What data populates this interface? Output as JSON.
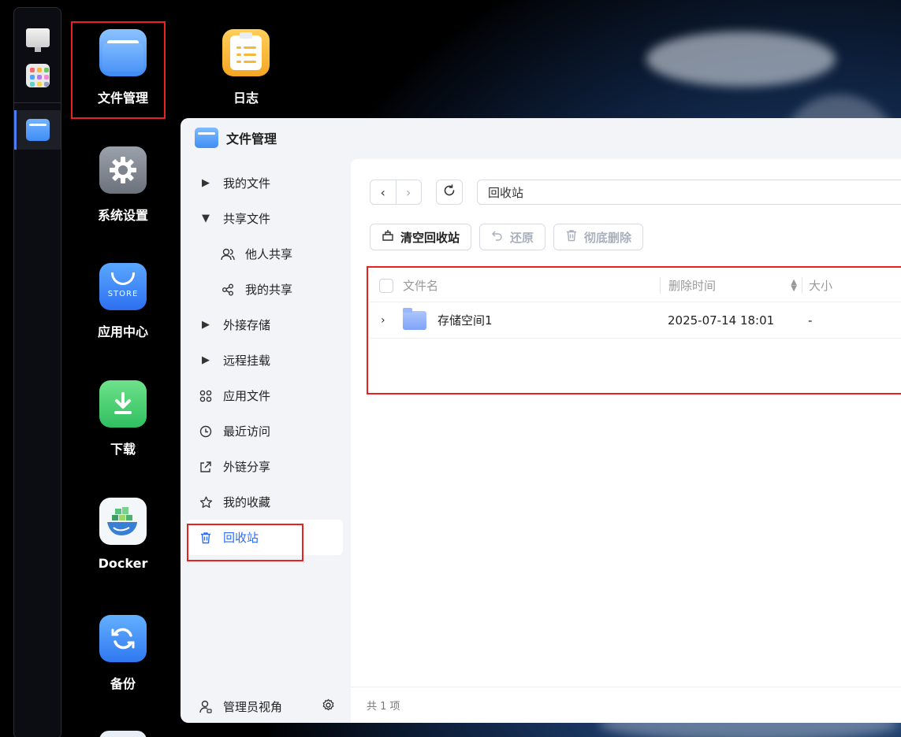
{
  "desktop": {
    "icons": [
      {
        "label": "文件管理"
      },
      {
        "label": "日志"
      },
      {
        "label": "系统设置"
      },
      {
        "label": "应用中心",
        "tile_text": "STORE"
      },
      {
        "label": "下载"
      },
      {
        "label": "Docker"
      },
      {
        "label": "备份"
      }
    ]
  },
  "window": {
    "title": "文件管理",
    "nav": [
      {
        "label": "我的文件",
        "icon": "caret-right-icon"
      },
      {
        "label": "共享文件",
        "icon": "caret-down-icon"
      },
      {
        "label": "他人共享",
        "icon": "users-icon"
      },
      {
        "label": "我的共享",
        "icon": "share-icon"
      },
      {
        "label": "外接存储",
        "icon": "caret-right-icon"
      },
      {
        "label": "远程挂载",
        "icon": "caret-right-icon"
      },
      {
        "label": "应用文件",
        "icon": "apps-icon"
      },
      {
        "label": "最近访问",
        "icon": "clock-icon"
      },
      {
        "label": "外链分享",
        "icon": "external-share-icon"
      },
      {
        "label": "我的收藏",
        "icon": "star-icon"
      },
      {
        "label": "回收站",
        "icon": "trash-icon"
      }
    ],
    "admin_view": "管理员视角",
    "path": "回收站",
    "actions": {
      "empty": "清空回收站",
      "restore": "还原",
      "delete": "彻底删除"
    },
    "table": {
      "headers": {
        "name": "文件名",
        "time": "删除时间",
        "size": "大小"
      },
      "rows": [
        {
          "name": "存储空间1",
          "time": "2025-07-14 18:01",
          "size": "-"
        }
      ]
    },
    "footer": "共 1 项"
  },
  "colors": {
    "accent": "#2f6df6",
    "highlight_box": "#e8231f"
  }
}
